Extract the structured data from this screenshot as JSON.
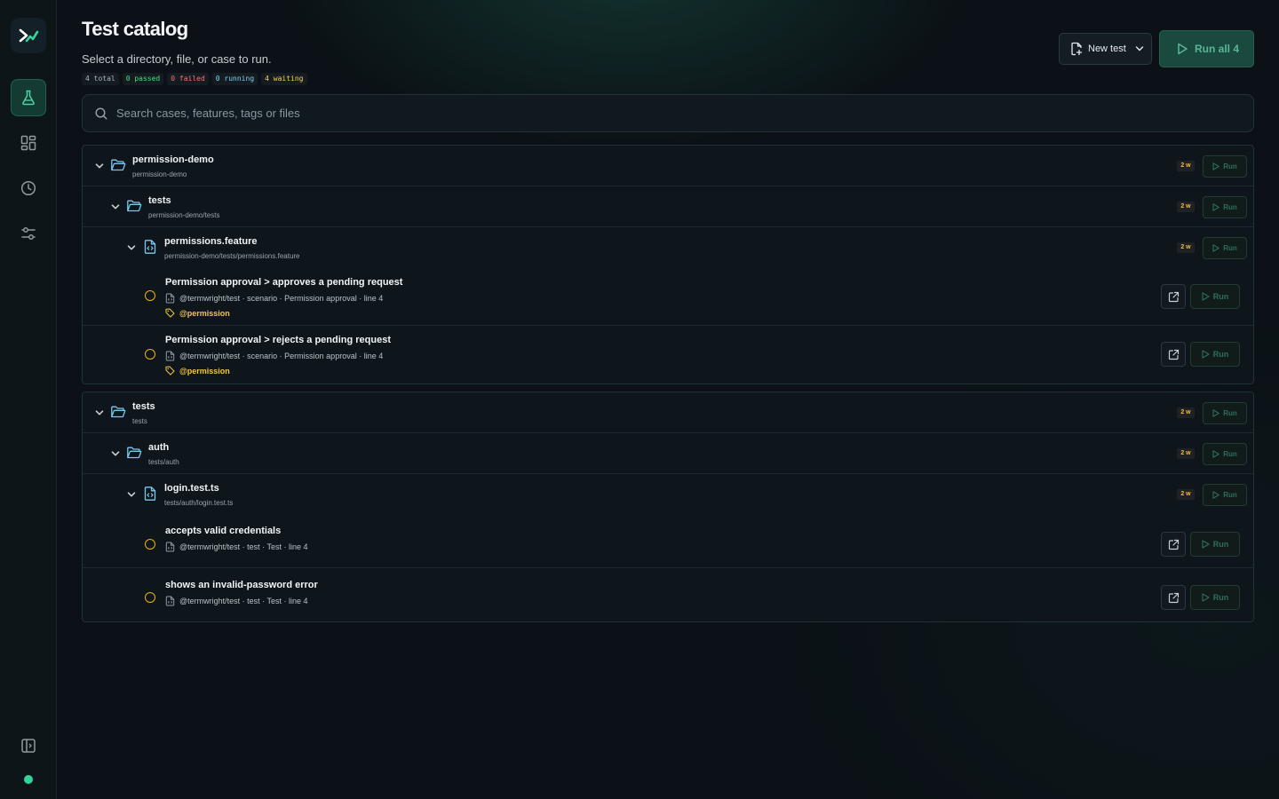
{
  "sidebar": {
    "items": [
      {
        "icon": "flask-icon",
        "active": true
      },
      {
        "icon": "dashboard-icon",
        "active": false
      },
      {
        "icon": "history-clock-icon",
        "active": false
      },
      {
        "icon": "sliders-icon",
        "active": false
      }
    ],
    "status_color": "#34d399"
  },
  "header": {
    "title": "Test catalog",
    "subtitle": "Select a directory, file, or case to run.",
    "counts": {
      "total": "4 total",
      "passed": "0 passed",
      "failed": "0 failed",
      "running": "0 running",
      "waiting": "4 waiting"
    },
    "new_test_label": "New test",
    "run_all_label": "Run all 4"
  },
  "search": {
    "placeholder": "Search cases, features, tags or files"
  },
  "run_label": "Run",
  "groups": [
    {
      "rows": [
        {
          "name": "permission-demo",
          "path": "permission-demo",
          "badge": "2 w"
        },
        {
          "name": "tests",
          "path": "permission-demo/tests",
          "badge": "2 w"
        },
        {
          "name": "permissions.feature",
          "path": "permission-demo/tests/permissions.feature",
          "badge": "2 w"
        }
      ],
      "cases": [
        {
          "name": "Permission approval > approves a pending request",
          "meta": "@termwright/test · scenario · Permission approval · line 4",
          "tag": "@permission"
        },
        {
          "name": "Permission approval > rejects a pending request",
          "meta": "@termwright/test · scenario · Permission approval · line 4",
          "tag": "@permission"
        }
      ]
    },
    {
      "rows": [
        {
          "name": "tests",
          "path": "tests",
          "badge": "2 w"
        },
        {
          "name": "auth",
          "path": "tests/auth",
          "badge": "2 w"
        },
        {
          "name": "login.test.ts",
          "path": "tests/auth/login.test.ts",
          "badge": "2 w"
        }
      ],
      "cases": [
        {
          "name": "accepts valid credentials",
          "meta": "@termwright/test · test · Test · line 4"
        },
        {
          "name": "shows an invalid-password error",
          "meta": "@termwright/test · test · Test · line 4"
        }
      ]
    }
  ]
}
